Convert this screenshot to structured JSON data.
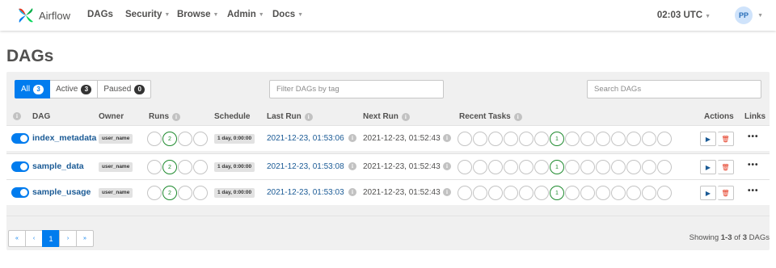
{
  "nav": {
    "brand": "Airflow",
    "items": [
      {
        "label": "DAGs",
        "caret": false
      },
      {
        "label": "Security",
        "caret": true
      },
      {
        "label": "Browse",
        "caret": true
      },
      {
        "label": "Admin",
        "caret": true
      },
      {
        "label": "Docs",
        "caret": true
      }
    ],
    "time": "02:03 UTC",
    "user_initials": "PP"
  },
  "page": {
    "title": "DAGs"
  },
  "filters": {
    "all": {
      "label": "All",
      "count": "3"
    },
    "active": {
      "label": "Active",
      "count": "3"
    },
    "paused": {
      "label": "Paused",
      "count": "0"
    },
    "tag_placeholder": "Filter DAGs by tag",
    "search_placeholder": "Search DAGs"
  },
  "table": {
    "headers": {
      "dag": "DAG",
      "owner": "Owner",
      "runs": "Runs",
      "schedule": "Schedule",
      "last_run": "Last Run",
      "next_run": "Next Run",
      "recent_tasks": "Recent Tasks",
      "actions": "Actions",
      "links": "Links"
    },
    "rows": [
      {
        "name": "index_metadata",
        "owner": "user_name",
        "runs_success": "2",
        "schedule": "1 day, 0:00:00",
        "last_run": "2021-12-23, 01:53:06",
        "next_run": "2021-12-23, 01:52:43",
        "recent_tasks_success": "1"
      },
      {
        "name": "sample_data",
        "owner": "user_name",
        "runs_success": "2",
        "schedule": "1 day, 0:00:00",
        "last_run": "2021-12-23, 01:53:08",
        "next_run": "2021-12-23, 01:52:43",
        "recent_tasks_success": "1"
      },
      {
        "name": "sample_usage",
        "owner": "user_name",
        "runs_success": "2",
        "schedule": "1 day, 0:00:00",
        "last_run": "2021-12-23, 01:53:03",
        "next_run": "2021-12-23, 01:52:43",
        "recent_tasks_success": "1"
      }
    ]
  },
  "pagination": {
    "first": "«",
    "prev": "‹",
    "current": "1",
    "next": "›",
    "last": "»",
    "showing_prefix": "Showing",
    "showing_range": "1-3",
    "showing_of": "of",
    "showing_total": "3",
    "showing_suffix": "DAGs"
  },
  "icons": {
    "info": "info-icon",
    "play": "play-icon",
    "delete": "trash-icon",
    "more": "more-icon"
  },
  "colors": {
    "accent": "#017cee",
    "link": "#1a5a95",
    "success": "#1e8a2e",
    "danger": "#e43921"
  }
}
